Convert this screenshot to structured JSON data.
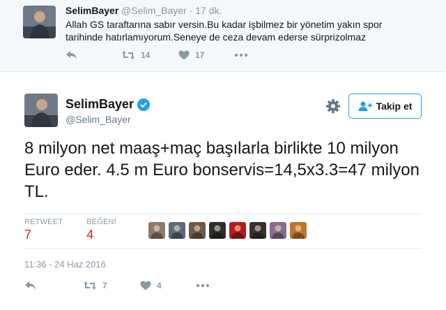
{
  "reply_context": {
    "name": "SelimBayer",
    "handle": "@Selim_Bayer",
    "separator": "·",
    "time": "17 dk.",
    "text": "Allah GS taraftarına sabır versin.Bu kadar işbilmez bir yönetim yakın spor tarihinde hatırlamıyorum.Seneye de ceza devam ederse sürprizolmaz",
    "retweet_count": "14",
    "like_count": "17"
  },
  "tweet": {
    "name": "SelimBayer",
    "handle": "@Selim_Bayer",
    "verified": true,
    "follow_label": "Takip et",
    "text": "8 milyon net maaş+maç başılarla birlikte 10 milyon Euro eder. 4.5 m Euro bonservis=14,5x3.3=47 milyon TL.",
    "retweet_label": "RETWEET",
    "retweet_count": "7",
    "like_label": "BEĞENİ",
    "like_count": "4",
    "timestamp": "11:36 - 24 Haz 2016",
    "action_retweet_count": "7",
    "action_like_count": "4"
  },
  "colors": {
    "accent": "#1da1f2",
    "stat_value": "#c62a2a",
    "muted": "#8899a6",
    "parent_bg": "#f5f8fa"
  },
  "icons": {
    "reply": "reply-icon",
    "retweet": "retweet-icon",
    "like": "heart-icon",
    "more": "more-icon",
    "settings": "gear-icon",
    "follow": "follow-person-icon",
    "verified": "verified-badge-icon"
  },
  "liker_avatars": [
    {
      "name": "liker-avatar-1",
      "color": "#8d7a6a"
    },
    {
      "name": "liker-avatar-2",
      "color": "#5a6b7c"
    },
    {
      "name": "liker-avatar-3",
      "color": "#6e5a48"
    },
    {
      "name": "liker-avatar-4",
      "color": "#2d2d2d"
    },
    {
      "name": "liker-avatar-5",
      "color": "#b51d1d"
    },
    {
      "name": "liker-avatar-6",
      "color": "#3a3030"
    },
    {
      "name": "liker-avatar-7",
      "color": "#8a6d8e"
    },
    {
      "name": "liker-avatar-8",
      "color": "#c0752e"
    }
  ]
}
